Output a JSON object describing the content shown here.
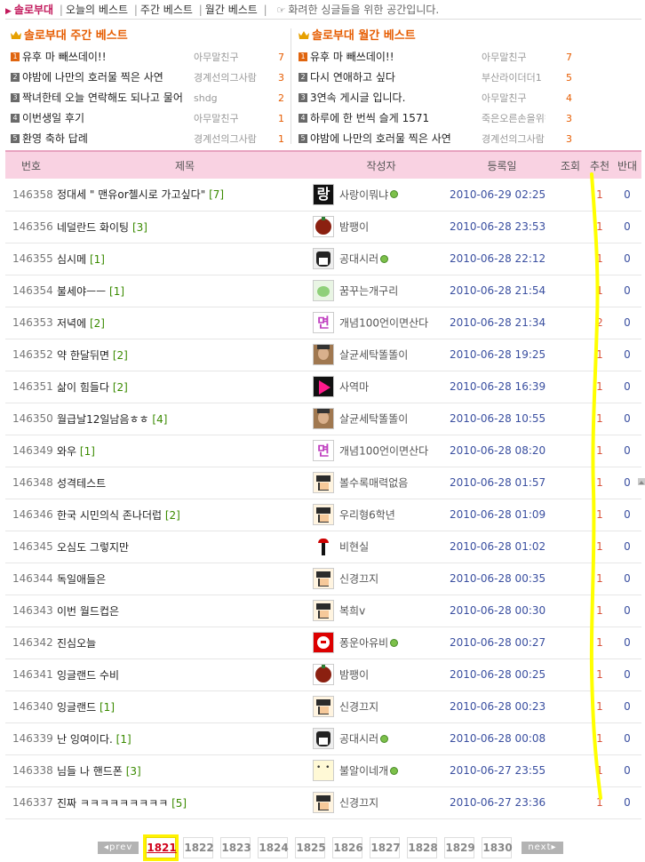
{
  "nav": {
    "brand": "솔로부대",
    "links": [
      "오늘의 베스트",
      "주간 베스트",
      "월간 베스트"
    ],
    "tagline": "화려한 싱글들을 위한 공간입니다."
  },
  "weekly_best": {
    "title": "솔로부대 주간 베스트",
    "items": [
      {
        "rank": "1",
        "title": "유후 마 빼쓰데이!!",
        "author": "아무말친구",
        "count": "7"
      },
      {
        "rank": "2",
        "title": "야밤에 나만의 호러물 찍은 사연",
        "author": "경계선의그사람",
        "count": "3"
      },
      {
        "rank": "3",
        "title": "짝녀한테 오늘 연락해도 되나고 물어",
        "author": "shdg",
        "count": "2"
      },
      {
        "rank": "4",
        "title": "이번생일 후기",
        "author": "아무말친구",
        "count": "1"
      },
      {
        "rank": "5",
        "title": "환영 축하 답례",
        "author": "경계선의그사람",
        "count": "1"
      }
    ]
  },
  "monthly_best": {
    "title": "솔로부대 월간 베스트",
    "items": [
      {
        "rank": "1",
        "title": "유후 마 빼쓰데이!!",
        "author": "아무말친구",
        "count": "7"
      },
      {
        "rank": "2",
        "title": "다시 연애하고 싶다",
        "author": "부산라이더더1",
        "count": "5"
      },
      {
        "rank": "3",
        "title": "3연속 게시글 입니다.",
        "author": "아무말친구",
        "count": "4"
      },
      {
        "rank": "4",
        "title": "하루에 한 번씩 슬게 1571",
        "author": "죽은오른손을위해",
        "count": "3"
      },
      {
        "rank": "5",
        "title": "야밤에 나만의 호러물 찍은 사연",
        "author": "경계선의그사람",
        "count": "3"
      }
    ]
  },
  "table": {
    "headers": {
      "no": "번호",
      "title": "제목",
      "author": "작성자",
      "date": "등록일",
      "views": "조회",
      "rec": "추천",
      "opp": "반대"
    },
    "rows": [
      {
        "no": "146358",
        "title": "정대세 \" 맨유or첼시로 가고싶다\"",
        "comments": "[7]",
        "author": "사랑이뭐냐",
        "avatar": "char",
        "avatar_text": "랑",
        "online": true,
        "date": "2010-06-29 02:25",
        "rec": "1",
        "opp": "0"
      },
      {
        "no": "146356",
        "title": "네덜란드 화이팅",
        "comments": "[3]",
        "author": "밤팽이",
        "avatar": "ball",
        "avatar_text": "",
        "online": false,
        "date": "2010-06-28 23:53",
        "rec": "1",
        "opp": "0"
      },
      {
        "no": "146355",
        "title": "심시메",
        "comments": "[1]",
        "author": "공대시러",
        "avatar": "mono",
        "avatar_text": "",
        "online": true,
        "date": "2010-06-28 22:12",
        "rec": "1",
        "opp": "0"
      },
      {
        "no": "146354",
        "title": "불세야ㅡㅡ",
        "comments": "[1]",
        "author": "꿈꾸는개구리",
        "avatar": "green",
        "avatar_text": "",
        "online": false,
        "date": "2010-06-28 21:54",
        "rec": "1",
        "opp": "0"
      },
      {
        "no": "146353",
        "title": "저녁에",
        "comments": "[2]",
        "author": "개념100언이면산다",
        "avatar": "pink",
        "avatar_text": "면",
        "online": false,
        "date": "2010-06-28 21:34",
        "rec": "2",
        "opp": "0"
      },
      {
        "no": "146352",
        "title": "약 한달뒤면",
        "comments": "[2]",
        "author": "살균세탁똘똘이",
        "avatar": "photo",
        "avatar_text": "",
        "online": false,
        "date": "2010-06-28 19:25",
        "rec": "1",
        "opp": "0"
      },
      {
        "no": "146351",
        "title": "삶이 힘들다",
        "comments": "[2]",
        "author": "사역마",
        "avatar": "play",
        "avatar_text": "",
        "online": false,
        "date": "2010-06-28 16:39",
        "rec": "1",
        "opp": "0"
      },
      {
        "no": "146350",
        "title": "월급날12일남음ㅎㅎ",
        "comments": "[4]",
        "author": "살균세탁똘똘이",
        "avatar": "photo",
        "avatar_text": "",
        "online": false,
        "date": "2010-06-28 10:55",
        "rec": "1",
        "opp": "0"
      },
      {
        "no": "146349",
        "title": "와우",
        "comments": "[1]",
        "author": "개념100언이면산다",
        "avatar": "pink",
        "avatar_text": "면",
        "online": false,
        "date": "2010-06-28 08:20",
        "rec": "1",
        "opp": "0"
      },
      {
        "no": "146348",
        "title": "성격테스트",
        "comments": "",
        "author": "볼수록매력없음",
        "avatar": "pixel",
        "avatar_text": "",
        "online": false,
        "date": "2010-06-28 01:57",
        "rec": "1",
        "opp": "0"
      },
      {
        "no": "146346",
        "title": "한국 시민의식 존나더럽",
        "comments": "[2]",
        "author": "우리형6학년",
        "avatar": "pixel",
        "avatar_text": "",
        "online": false,
        "date": "2010-06-28 01:09",
        "rec": "1",
        "opp": "0"
      },
      {
        "no": "146345",
        "title": "오심도 그렇지만",
        "comments": "",
        "author": "비현실",
        "avatar": "stick",
        "avatar_text": "",
        "online": false,
        "date": "2010-06-28 01:02",
        "rec": "1",
        "opp": "0"
      },
      {
        "no": "146344",
        "title": "독일애들은",
        "comments": "",
        "author": "신경끄지",
        "avatar": "pixel",
        "avatar_text": "",
        "online": false,
        "date": "2010-06-28 00:35",
        "rec": "1",
        "opp": "0"
      },
      {
        "no": "146343",
        "title": "이번 월드컵은",
        "comments": "",
        "author": "복희v",
        "avatar": "pixel",
        "avatar_text": "",
        "online": false,
        "date": "2010-06-28 00:30",
        "rec": "1",
        "opp": "0"
      },
      {
        "no": "146342",
        "title": "진심오늘",
        "comments": "",
        "author": "퐁운아유비",
        "avatar": "red",
        "avatar_text": "",
        "online": true,
        "date": "2010-06-28 00:27",
        "rec": "1",
        "opp": "0"
      },
      {
        "no": "146341",
        "title": "잉글랜드 수비",
        "comments": "",
        "author": "밤팽이",
        "avatar": "ball",
        "avatar_text": "",
        "online": false,
        "date": "2010-06-28 00:25",
        "rec": "1",
        "opp": "0"
      },
      {
        "no": "146340",
        "title": "잉글랜드",
        "comments": "[1]",
        "author": "신경끄지",
        "avatar": "pixel",
        "avatar_text": "",
        "online": false,
        "date": "2010-06-28 00:23",
        "rec": "1",
        "opp": "0"
      },
      {
        "no": "146339",
        "title": "난 잉여이다.",
        "comments": "[1]",
        "author": "공대시러",
        "avatar": "mono",
        "avatar_text": "",
        "online": true,
        "date": "2010-06-28 00:08",
        "rec": "1",
        "opp": "0"
      },
      {
        "no": "146338",
        "title": "님들 나 핸드폰",
        "comments": "[3]",
        "author": "불알이네개",
        "avatar": "face",
        "avatar_text": "",
        "online": true,
        "date": "2010-06-27 23:55",
        "rec": "1",
        "opp": "0"
      },
      {
        "no": "146337",
        "title": "진짜 ㅋㅋㅋㅋㅋㅋㅋㅋㅋ",
        "comments": "[5]",
        "author": "신경끄지",
        "avatar": "pixel",
        "avatar_text": "",
        "online": false,
        "date": "2010-06-27 23:36",
        "rec": "1",
        "opp": "0"
      }
    ]
  },
  "pager": {
    "prev": "prev",
    "next": "next",
    "pages": [
      "1821",
      "1822",
      "1823",
      "1824",
      "1825",
      "1826",
      "1827",
      "1828",
      "1829",
      "1830"
    ],
    "current": "1821"
  },
  "colors": {
    "accent": "#c2185b",
    "best": "#e65c00",
    "header_bg": "#f9d2e2",
    "highlight": "#fff200"
  }
}
